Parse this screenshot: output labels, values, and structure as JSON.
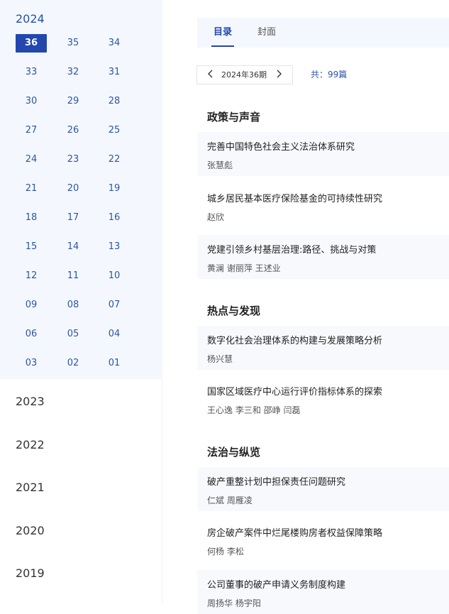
{
  "years": {
    "active": {
      "year": "2024",
      "issues": [
        "36",
        "35",
        "34",
        "33",
        "32",
        "31",
        "30",
        "29",
        "28",
        "27",
        "26",
        "25",
        "24",
        "23",
        "22",
        "21",
        "20",
        "19",
        "18",
        "17",
        "16",
        "15",
        "14",
        "13",
        "12",
        "11",
        "10",
        "09",
        "08",
        "07",
        "06",
        "05",
        "04",
        "03",
        "02",
        "01"
      ],
      "selected_issue": "36"
    },
    "others": [
      "2023",
      "2022",
      "2021",
      "2020",
      "2019"
    ]
  },
  "tabs": [
    {
      "label": "目录",
      "active": true
    },
    {
      "label": "封面",
      "active": false
    }
  ],
  "selector": {
    "label": "2024年36期",
    "prev_icon": "chevron-left-icon",
    "next_icon": "chevron-right-icon"
  },
  "total": "共：99篇",
  "sections": [
    {
      "title": "政策与声音",
      "articles": [
        {
          "title": "完善中国特色社会主义法治体系研究",
          "authors": "张慧彪"
        },
        {
          "title": "城乡居民基本医疗保险基金的可持续性研究",
          "authors": "赵欣"
        },
        {
          "title": "党建引领乡村基层治理:路径、挑战与对策",
          "authors": "黄澜  谢丽萍  王述业"
        }
      ]
    },
    {
      "title": "热点与发现",
      "articles": [
        {
          "title": "数字化社会治理体系的构建与发展策略分析",
          "authors": "杨兴慧"
        },
        {
          "title": "国家区域医疗中心运行评价指标体系的探索",
          "authors": "王心逸  李三和  邵峥  闫磊"
        }
      ]
    },
    {
      "title": "法治与纵览",
      "articles": [
        {
          "title": "破产重整计划中担保责任问题研究",
          "authors": "仁斌  周雁凌"
        },
        {
          "title": "房企破产案件中烂尾楼购房者权益保障策略",
          "authors": "何杨  李松"
        },
        {
          "title": "公司董事的破产申请义务制度构建",
          "authors": "周扬华  杨宇阳"
        }
      ]
    }
  ],
  "colors": {
    "accent": "#2347ad",
    "link": "#2d55a5",
    "panel_bg": "#f4f8fe",
    "row_shade": "#f7f9fc"
  }
}
